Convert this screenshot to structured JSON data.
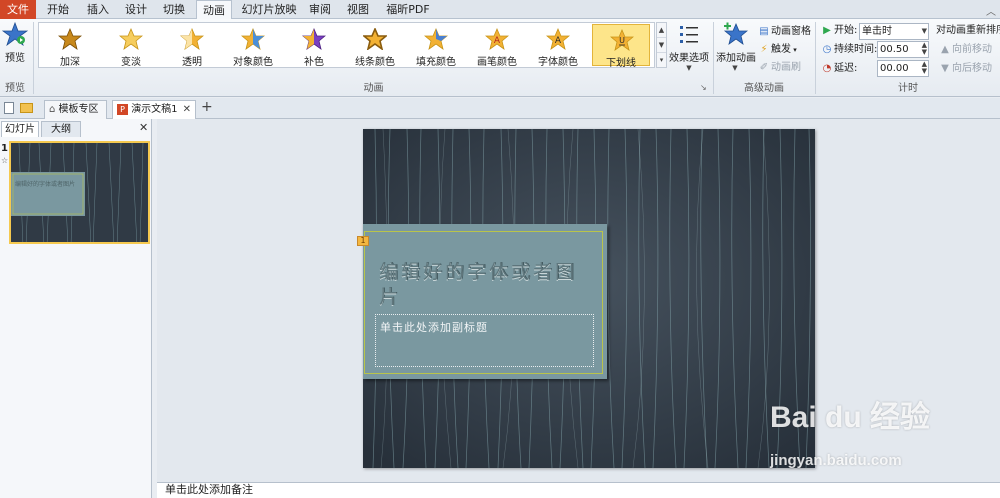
{
  "menu": {
    "items": [
      "文件",
      "开始",
      "插入",
      "设计",
      "切换",
      "动画",
      "幻灯片放映",
      "审阅",
      "视图",
      "福昕PDF"
    ],
    "active": "动画"
  },
  "ribbon": {
    "preview": {
      "label": "预览",
      "group": "预览"
    },
    "animation_group": {
      "label": "动画",
      "effects": [
        "加深",
        "变淡",
        "透明",
        "对象颜色",
        "补色",
        "线条颜色",
        "填充颜色",
        "画笔颜色",
        "字体颜色",
        "下划线"
      ],
      "selected": "下划线",
      "effect_options": "效果选项"
    },
    "advanced": {
      "label": "高级动画",
      "add_animation": "添加动画",
      "animation_pane": "动画窗格",
      "trigger": "触发",
      "animation_painter": "动画刷"
    },
    "timing": {
      "label": "计时",
      "start_label": "开始:",
      "start_value": "单击时",
      "duration_label": "持续时间:",
      "duration_value": "00.50",
      "delay_label": "延迟:",
      "delay_value": "00.00",
      "reorder_title": "对动画重新排序",
      "move_earlier": "向前移动",
      "move_later": "向后移动"
    }
  },
  "doc_tabs": {
    "template": "模板专区",
    "document": "演示文稿1",
    "new_tab": "+"
  },
  "left_panel": {
    "tabs": [
      "幻灯片",
      "大纲"
    ],
    "slide_number": "1",
    "thumb_title": "编辑好的字体或者图片"
  },
  "slide": {
    "title": "编辑好的字体或者图片",
    "subtitle_placeholder": "单击此处添加副标题",
    "animation_marker": "1"
  },
  "notes_placeholder": "单击此处添加备注",
  "watermark": {
    "logo": "Bai du 经验",
    "url": "jingyan.baidu.com"
  },
  "colors": {
    "file_tab": "#d24726",
    "selected_effect": "#fde58a",
    "slide_background": "#303a45",
    "slide_lines": "#7fa3aa",
    "title_box": "#7a98a0",
    "star_gold": "#f2b134"
  }
}
